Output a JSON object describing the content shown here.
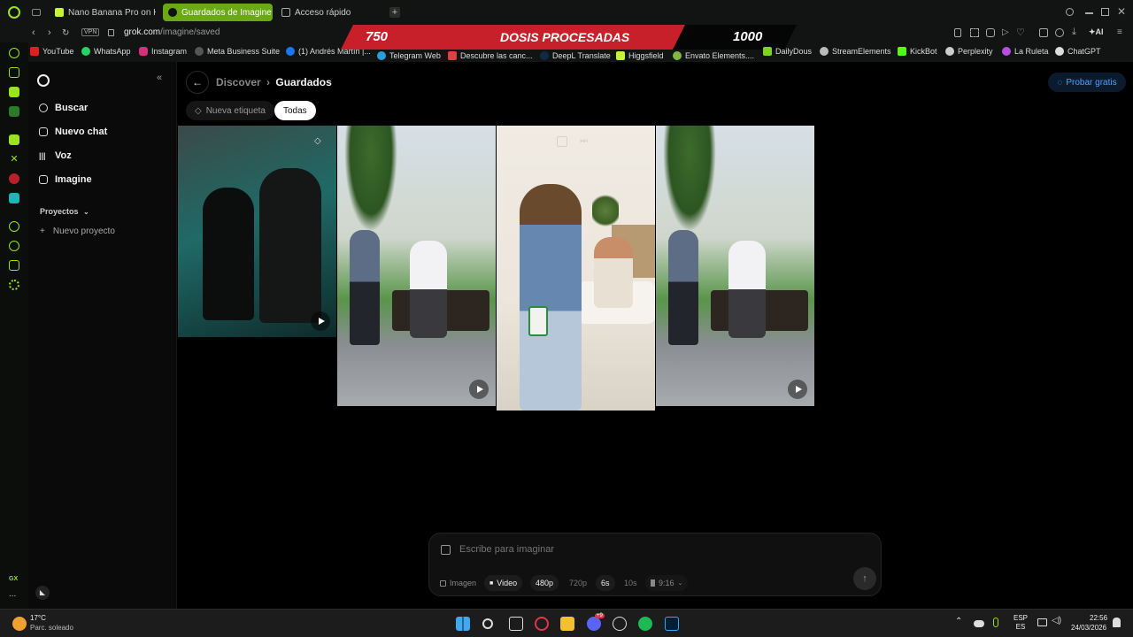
{
  "browser": {
    "tabs": [
      {
        "title": "Nano Banana Pro on Higgs",
        "active": false
      },
      {
        "title": "Guardados de Imagine - G",
        "active": true
      },
      {
        "title": "Acceso rápido",
        "active": false
      }
    ],
    "vpn_label": "VPN",
    "url_host": "grok.com",
    "url_path": "/imagine/saved",
    "ai_label": "AI",
    "bookmarks": [
      "YouTube",
      "WhatsApp",
      "Instagram",
      "Meta Business Suite",
      "(1) Andrés Martín |...",
      "Telegram Web",
      "Descubre las canc...",
      "DeepL Translate",
      "Higgsfield",
      "Envato Elements....",
      "DailyDous",
      "StreamElements",
      "KickBot",
      "Perplexity",
      "La Ruleta",
      "ChatGPT"
    ]
  },
  "banner": {
    "left_value": "750",
    "title": "DOSIS PROCESADAS",
    "right_value": "1000"
  },
  "rail": {
    "gx_label": "GX",
    "more_label": "..."
  },
  "sidebar": {
    "nav": [
      {
        "label": "Buscar",
        "icon": "search-icon"
      },
      {
        "label": "Nuevo chat",
        "icon": "edit-icon"
      },
      {
        "label": "Voz",
        "icon": "voice-icon"
      },
      {
        "label": "Imagine",
        "icon": "image-icon"
      }
    ],
    "projects_label": "Proyectos",
    "new_project_label": "Nuevo proyecto"
  },
  "header": {
    "breadcrumb_parent": "Discover",
    "breadcrumb_separator": "›",
    "breadcrumb_current": "Guardados",
    "try_free_label": "Probar gratis"
  },
  "filters": {
    "new_tag_label": "Nueva etiqueta",
    "all_label": "Todas"
  },
  "composer": {
    "placeholder": "Escribe para imaginar",
    "options": {
      "image": "Imagen",
      "video": "Video",
      "res_480": "480p",
      "res_720": "720p",
      "dur_6": "6s",
      "dur_10": "10s",
      "aspect": "9:16"
    }
  },
  "taskbar": {
    "temperature": "17°C",
    "weather": "Parc. soleado",
    "lang_top": "ESP",
    "lang_bottom": "ES",
    "time": "22:56",
    "date": "24/03/2026",
    "discord_badge": "+9"
  },
  "colors": {
    "accent_green": "#9be21f",
    "banner_red": "#c8202b",
    "link_blue": "#4aa3ff"
  }
}
